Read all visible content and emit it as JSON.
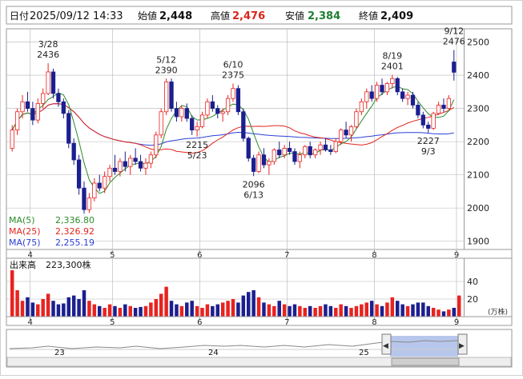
{
  "header": {
    "date_label": "日付",
    "datetime": "2025/09/12 14:33",
    "open_label": "始値",
    "open_value": "2,448",
    "high_label": "高値",
    "high_value": "2,476",
    "low_label": "安値",
    "low_value": "2,384",
    "close_label": "終値",
    "close_value": "2,409"
  },
  "colors": {
    "up": "#e8231f",
    "down": "#1b1f8f",
    "ma5": "#2d8a2d",
    "ma25": "#e0261f",
    "ma75": "#2c3fd6",
    "high_text": "#d9261c",
    "low_text": "#1e7f33",
    "grid": "#b5b5b5"
  },
  "chart_data": [
    {
      "type": "candlestick",
      "name": "price",
      "y_ticks": [
        "2500",
        "2400",
        "2300",
        "2200",
        "2100",
        "2000",
        "1900"
      ],
      "ylim": [
        1875,
        2540
      ],
      "x_ticks": [
        "4",
        "5",
        "6",
        "7",
        "8",
        "9"
      ],
      "legend": [
        {
          "label": "MA(5)",
          "value": "2,336.80",
          "color_key": "ma5"
        },
        {
          "label": "MA(25)",
          "value": "2,326.92",
          "color_key": "ma25"
        },
        {
          "label": "MA(75)",
          "value": "2,255.19",
          "color_key": "ma75"
        }
      ],
      "annotations": [
        {
          "date": "3/28",
          "price": "2436",
          "position": "above"
        },
        {
          "date": "5/12",
          "price": "2390",
          "position": "above"
        },
        {
          "date": "6/10",
          "price": "2375",
          "position": "above"
        },
        {
          "date": "8/19",
          "price": "2401",
          "position": "above"
        },
        {
          "date": "9/12",
          "price": "2476",
          "position": "above"
        },
        {
          "date": "5/23",
          "price": "2215",
          "position": "below"
        },
        {
          "date": "6/13",
          "price": "2096",
          "position": "below"
        },
        {
          "date": "9/3",
          "price": "2227",
          "position": "below"
        }
      ],
      "x_month_starts": [
        4,
        20,
        37,
        54,
        71,
        87
      ],
      "candles": [
        [
          2180,
          2250,
          2170,
          2235
        ],
        [
          2235,
          2300,
          2220,
          2290
        ],
        [
          2290,
          2340,
          2270,
          2320
        ],
        [
          2320,
          2350,
          2290,
          2300
        ],
        [
          2300,
          2320,
          2250,
          2265
        ],
        [
          2265,
          2330,
          2255,
          2315
        ],
        [
          2315,
          2360,
          2300,
          2345
        ],
        [
          2345,
          2436,
          2340,
          2410
        ],
        [
          2410,
          2420,
          2330,
          2345
        ],
        [
          2345,
          2360,
          2305,
          2320
        ],
        [
          2320,
          2330,
          2270,
          2285
        ],
        [
          2285,
          2295,
          2180,
          2195
        ],
        [
          2195,
          2210,
          2130,
          2145
        ],
        [
          2145,
          2160,
          2040,
          2060
        ],
        [
          2060,
          2080,
          1975,
          1995
        ],
        [
          1995,
          2045,
          1985,
          2030
        ],
        [
          2030,
          2090,
          2020,
          2075
        ],
        [
          2075,
          2100,
          2050,
          2060
        ],
        [
          2060,
          2110,
          2045,
          2095
        ],
        [
          2095,
          2130,
          2080,
          2120
        ],
        [
          2120,
          2160,
          2100,
          2110
        ],
        [
          2110,
          2150,
          2095,
          2140
        ],
        [
          2140,
          2170,
          2110,
          2125
        ],
        [
          2125,
          2160,
          2100,
          2150
        ],
        [
          2150,
          2180,
          2130,
          2140
        ],
        [
          2140,
          2160,
          2110,
          2120
        ],
        [
          2120,
          2150,
          2100,
          2135
        ],
        [
          2135,
          2170,
          2120,
          2160
        ],
        [
          2160,
          2230,
          2150,
          2220
        ],
        [
          2220,
          2300,
          2210,
          2290
        ],
        [
          2290,
          2390,
          2280,
          2380
        ],
        [
          2380,
          2390,
          2290,
          2300
        ],
        [
          2300,
          2320,
          2260,
          2275
        ],
        [
          2275,
          2310,
          2260,
          2300
        ],
        [
          2300,
          2315,
          2260,
          2270
        ],
        [
          2270,
          2280,
          2220,
          2235
        ],
        [
          2235,
          2260,
          2215,
          2245
        ],
        [
          2245,
          2290,
          2240,
          2280
        ],
        [
          2280,
          2330,
          2270,
          2320
        ],
        [
          2320,
          2340,
          2290,
          2300
        ],
        [
          2300,
          2310,
          2270,
          2285
        ],
        [
          2285,
          2300,
          2260,
          2290
        ],
        [
          2290,
          2340,
          2280,
          2330
        ],
        [
          2330,
          2375,
          2320,
          2360
        ],
        [
          2360,
          2370,
          2280,
          2290
        ],
        [
          2290,
          2300,
          2200,
          2210
        ],
        [
          2210,
          2215,
          2140,
          2150
        ],
        [
          2150,
          2160,
          2096,
          2110
        ],
        [
          2110,
          2170,
          2105,
          2160
        ],
        [
          2160,
          2180,
          2120,
          2130
        ],
        [
          2130,
          2150,
          2100,
          2140
        ],
        [
          2140,
          2180,
          2130,
          2175
        ],
        [
          2175,
          2200,
          2150,
          2160
        ],
        [
          2160,
          2190,
          2150,
          2180
        ],
        [
          2180,
          2200,
          2160,
          2170
        ],
        [
          2170,
          2180,
          2130,
          2140
        ],
        [
          2140,
          2170,
          2120,
          2160
        ],
        [
          2160,
          2190,
          2150,
          2185
        ],
        [
          2185,
          2200,
          2150,
          2160
        ],
        [
          2160,
          2180,
          2150,
          2175
        ],
        [
          2175,
          2200,
          2160,
          2190
        ],
        [
          2190,
          2210,
          2170,
          2175
        ],
        [
          2175,
          2190,
          2160,
          2170
        ],
        [
          2170,
          2210,
          2165,
          2200
        ],
        [
          2200,
          2240,
          2190,
          2235
        ],
        [
          2235,
          2260,
          2210,
          2220
        ],
        [
          2220,
          2250,
          2200,
          2245
        ],
        [
          2245,
          2300,
          2240,
          2290
        ],
        [
          2290,
          2330,
          2280,
          2320
        ],
        [
          2320,
          2360,
          2300,
          2350
        ],
        [
          2350,
          2370,
          2320,
          2330
        ],
        [
          2330,
          2380,
          2320,
          2370
        ],
        [
          2370,
          2390,
          2340,
          2350
        ],
        [
          2350,
          2380,
          2340,
          2375
        ],
        [
          2375,
          2401,
          2360,
          2390
        ],
        [
          2390,
          2395,
          2340,
          2350
        ],
        [
          2350,
          2360,
          2320,
          2330
        ],
        [
          2330,
          2350,
          2310,
          2340
        ],
        [
          2340,
          2350,
          2300,
          2310
        ],
        [
          2310,
          2320,
          2270,
          2280
        ],
        [
          2280,
          2290,
          2240,
          2250
        ],
        [
          2250,
          2260,
          2227,
          2240
        ],
        [
          2240,
          2290,
          2235,
          2285
        ],
        [
          2285,
          2320,
          2280,
          2310
        ],
        [
          2310,
          2330,
          2290,
          2300
        ],
        [
          2300,
          2340,
          2295,
          2330
        ],
        [
          2440,
          2476,
          2384,
          2409
        ]
      ]
    },
    {
      "type": "bar",
      "name": "volume",
      "label": "出来高",
      "value_text": "223,300株",
      "unit": "(万株)",
      "y_ticks": [
        "40",
        "20"
      ],
      "ylim": [
        0,
        60
      ],
      "values": [
        58,
        30,
        18,
        22,
        16,
        14,
        20,
        26,
        18,
        14,
        15,
        22,
        24,
        20,
        30,
        18,
        14,
        12,
        10,
        14,
        12,
        10,
        14,
        12,
        10,
        11,
        12,
        16,
        20,
        26,
        34,
        18,
        14,
        12,
        16,
        18,
        12,
        10,
        14,
        12,
        14,
        16,
        18,
        20,
        16,
        24,
        28,
        30,
        22,
        16,
        14,
        12,
        18,
        14,
        12,
        14,
        12,
        10,
        12,
        10,
        12,
        14,
        12,
        10,
        14,
        12,
        10,
        12,
        14,
        16,
        18,
        14,
        12,
        16,
        22,
        18,
        14,
        12,
        14,
        16,
        16,
        12,
        10,
        8,
        6,
        8,
        10,
        24
      ]
    }
  ],
  "navigator": {
    "labels": [
      "23",
      "24",
      "25"
    ],
    "left_button": "◀",
    "right_button": "▶"
  }
}
